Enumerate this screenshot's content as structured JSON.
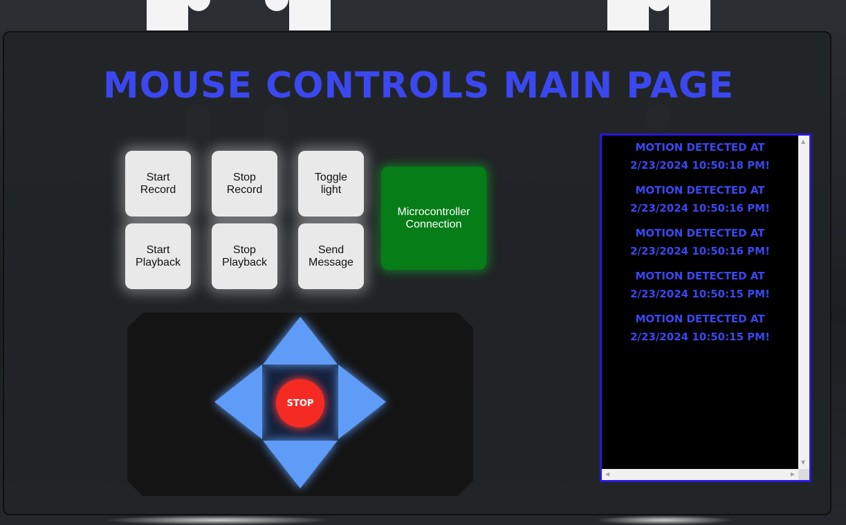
{
  "page": {
    "title": "MOUSE CONTROLS MAIN PAGE"
  },
  "controls": {
    "start_record": "Start\nRecord",
    "stop_record": "Stop\nRecord",
    "toggle_light": "Toggle\nlight",
    "start_playback": "Start\nPlayback",
    "stop_playback": "Stop\nPlayback",
    "send_message": "Send\nMessage",
    "microcontroller": "Microcontroller\nConnection",
    "stop": "STOP"
  },
  "log": {
    "entries": [
      "MOTION DETECTED AT\n2/23/2024  10:50:18 PM!",
      "MOTION DETECTED AT\n2/23/2024  10:50:16 PM!",
      "MOTION DETECTED AT\n2/23/2024  10:50:16 PM!",
      "MOTION DETECTED AT\n2/23/2024  10:50:15 PM!",
      "MOTION DETECTED AT\n2/23/2024  10:50:15 PM!"
    ]
  },
  "colors": {
    "title": "#3b48f0",
    "connection_ok": "#067d17",
    "stop": "#f52b23",
    "dpad": "#5f9cf8",
    "log_border": "#2b17e0"
  },
  "icons": {
    "up": "arrow-up-icon",
    "down": "arrow-down-icon",
    "left": "arrow-left-icon",
    "right": "arrow-right-icon"
  }
}
